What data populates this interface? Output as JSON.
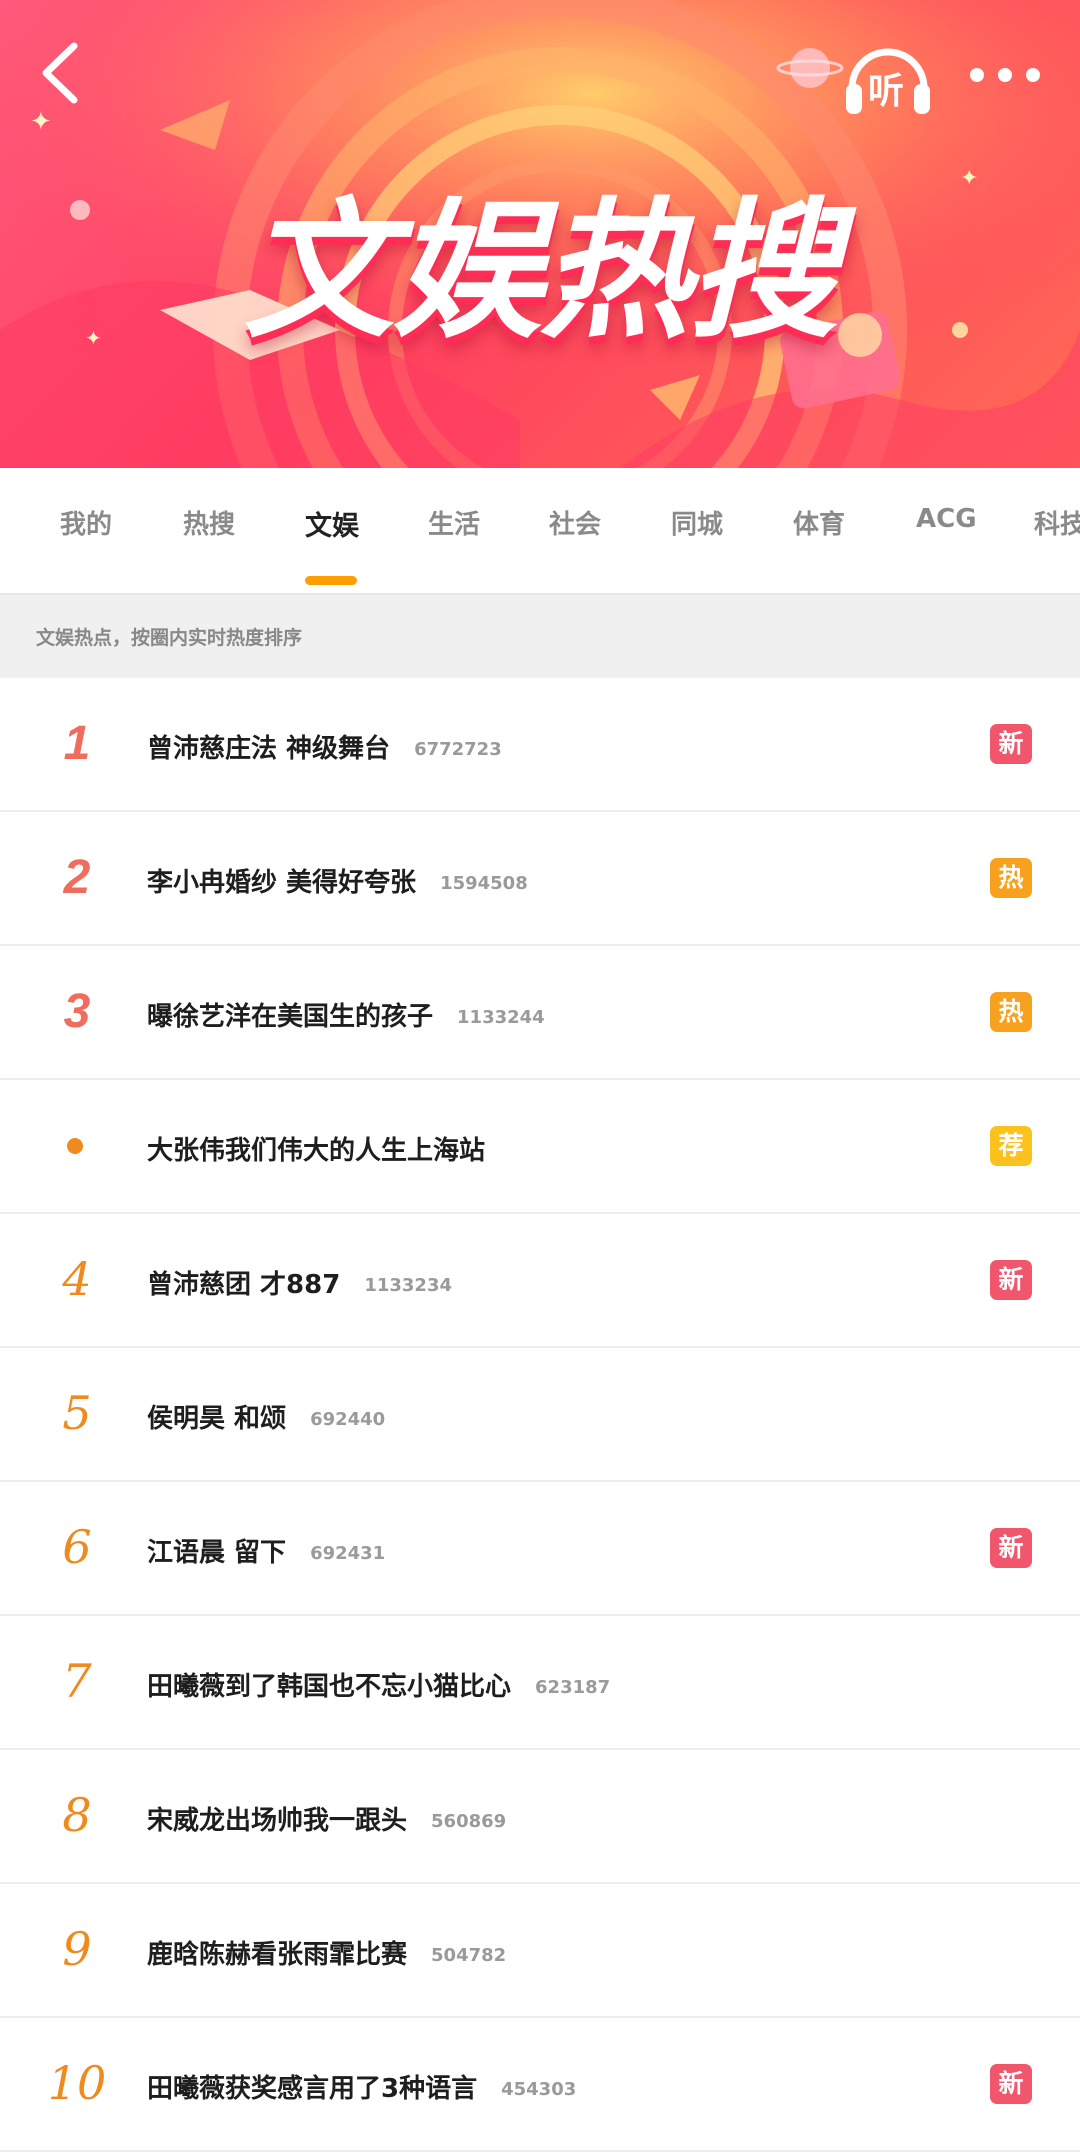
{
  "banner": {
    "title": "文娱热搜",
    "back_icon": "chevron-left-icon",
    "listen_label": "听",
    "more_icon": "more-dots-icon"
  },
  "tabs": [
    {
      "label": "我的",
      "active": false
    },
    {
      "label": "热搜",
      "active": false
    },
    {
      "label": "文娱",
      "active": true
    },
    {
      "label": "生活",
      "active": false
    },
    {
      "label": "社会",
      "active": false
    },
    {
      "label": "同城",
      "active": false
    },
    {
      "label": "体育",
      "active": false
    },
    {
      "label": "ACG",
      "active": false
    },
    {
      "label": "科技",
      "active": false
    }
  ],
  "subheader": "文娱热点，按圈内实时热度排序",
  "items": [
    {
      "rank": "1",
      "title": "曾沛慈庄法 神级舞台",
      "count": "6772723",
      "badge": "新",
      "badge_type": "new"
    },
    {
      "rank": "2",
      "title": "李小冉婚纱 美得好夸张",
      "count": "1594508",
      "badge": "热",
      "badge_type": "hot"
    },
    {
      "rank": "3",
      "title": "曝徐艺洋在美国生的孩子",
      "count": "1133244",
      "badge": "热",
      "badge_type": "hot"
    },
    {
      "rank": "",
      "title": "大张伟我们伟大的人生上海站",
      "count": "",
      "badge": "荐",
      "badge_type": "rec"
    },
    {
      "rank": "4",
      "title": "曾沛慈团 才887",
      "count": "1133234",
      "badge": "新",
      "badge_type": "new"
    },
    {
      "rank": "5",
      "title": "侯明昊 和颂",
      "count": "692440",
      "badge": "",
      "badge_type": ""
    },
    {
      "rank": "6",
      "title": "江语晨 留下",
      "count": "692431",
      "badge": "新",
      "badge_type": "new"
    },
    {
      "rank": "7",
      "title": "田曦薇到了韩国也不忘小猫比心",
      "count": "623187",
      "badge": "",
      "badge_type": ""
    },
    {
      "rank": "8",
      "title": "宋威龙出场帅我一跟头",
      "count": "560869",
      "badge": "",
      "badge_type": ""
    },
    {
      "rank": "9",
      "title": "鹿晗陈赫看张雨霏比赛",
      "count": "504782",
      "badge": "",
      "badge_type": ""
    },
    {
      "rank": "10",
      "title": "田曦薇获奖感言用了3种语言",
      "count": "454303",
      "badge": "新",
      "badge_type": "new"
    }
  ],
  "colors": {
    "tab_indicator": "#ffa000",
    "rank_top": "#f06c5d",
    "rank_other": "#ef8a1e",
    "badge_new": "#f0566c",
    "badge_hot": "#f7a11e",
    "badge_rec": "#fbc11c"
  }
}
